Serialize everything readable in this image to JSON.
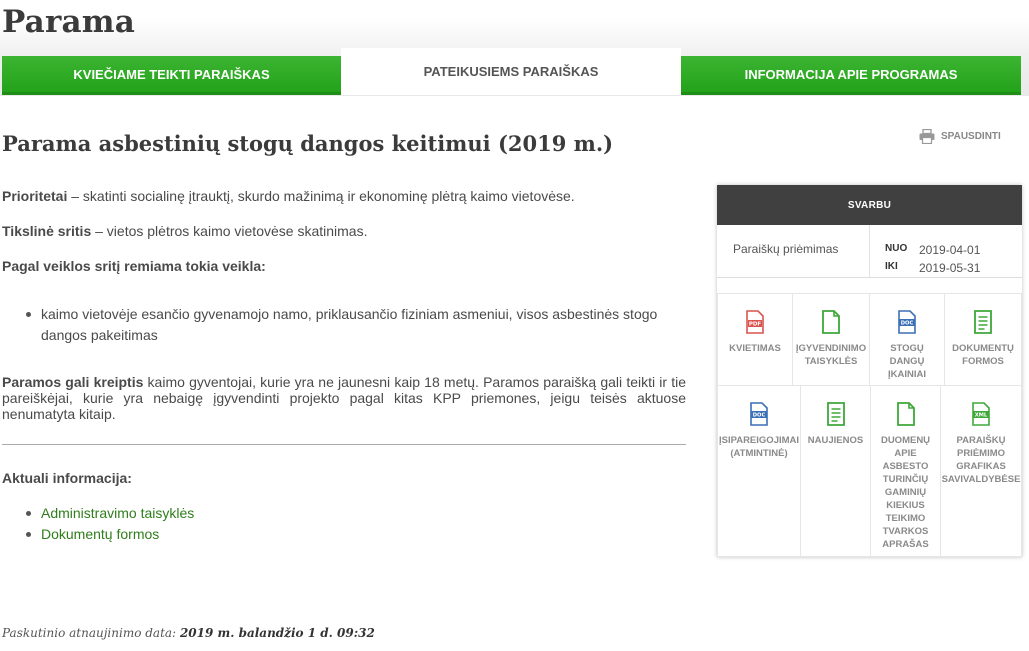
{
  "page": {
    "title": "Parama"
  },
  "tabs": [
    {
      "label": "KVIEČIAME TEIKTI PARAIŠKAS"
    },
    {
      "label": "PATEIKUSIEMS PARAIŠKAS"
    },
    {
      "label": "INFORMACIJA APIE PROGRAMAS"
    }
  ],
  "article": {
    "title": "Parama asbestinių stogų dangos keitimui (2019 m.)",
    "print_label": "SPAUSDINTI",
    "p1_bold": "Prioritetai",
    "p1_rest": " – skatinti socialinę įtrauktį, skurdo mažinimą ir ekonominę plėtrą kaimo vietovėse.",
    "p2_bold": "Tikslinė sritis",
    "p2_rest": " – vietos plėtros kaimo vietovėse skatinimas.",
    "p3": "Pagal veiklos sritį remiama tokia veikla:",
    "bullet": "kaimo vietovėje esančio gyvenamojo namo, priklausančio fiziniam asmeniui, visos asbestinės stogo dangos pakeitimas",
    "p4_bold": "Paramos gali kreiptis",
    "p4_rest": " kaimo gyventojai, kurie yra ne jaunesni kaip 18 metų. Paramos paraišką gali teikti ir tie pareiškėjai, kurie yra nebaigę įgyvendinti projekto pagal kitas KPP priemones, jeigu teisės aktuose nenumatyta kitaip.",
    "p5": "Aktuali informacija:",
    "links": [
      {
        "label": "Administravimo taisyklės"
      },
      {
        "label": "Dokumentų formos"
      }
    ],
    "updated_label": "Paskutinio atnaujinimo data:",
    "updated_value": "2019 m. balandžio 1 d. 09:32"
  },
  "panel": {
    "heading": "SVARBU",
    "label": "Paraiškų priėmimas",
    "from_key": "NUO",
    "from_value": "2019-04-01",
    "to_key": "IKI",
    "to_value": "2019-05-31",
    "items": [
      {
        "label": "KVIETIMAS",
        "icon": "pdf-icon"
      },
      {
        "label": "ĮGYVENDINIMO TAISYKLĖS",
        "icon": "document-icon"
      },
      {
        "label": "STOGŲ DANGŲ ĮKAINIAI",
        "icon": "doc-icon"
      },
      {
        "label": "DOKUMENTŲ FORMOS",
        "icon": "form-icon"
      },
      {
        "label": "ĮSIPAREIGOJIMAI (ATMINTINĖ)",
        "icon": "doc-icon"
      },
      {
        "label": "NAUJIENOS",
        "icon": "form-icon"
      },
      {
        "label": "DUOMENŲ APIE ASBESTO TURINČIŲ GAMINIŲ KIEKIUS TEIKIMO TVARKOS APRAŠAS",
        "icon": "document-icon"
      },
      {
        "label": "PARAIŠKŲ PRIĖMIMO GRAFIKAS SAVIVALDYBĖSE",
        "icon": "xml-icon"
      }
    ]
  },
  "colors": {
    "accent_green": "#24a21b",
    "link_green": "#2f7d1b",
    "panel_header": "#404040"
  }
}
